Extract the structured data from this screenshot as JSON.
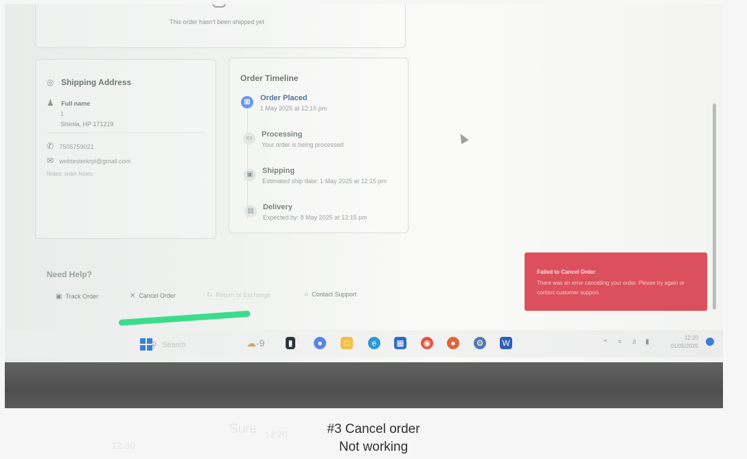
{
  "order_card": {
    "not_shipped_text": "This order hasn't been shipped yet"
  },
  "shipping": {
    "title": "Shipping Address",
    "full_name": "Full name",
    "line1": "1",
    "line2": "Shimla, HP 171219",
    "phone": "7505759021",
    "email": "webtesterkrpl@gmail.com",
    "notes": "Notes: order Notes"
  },
  "timeline": {
    "title": "Order Timeline",
    "steps": [
      {
        "title": "Order Placed",
        "subtitle": "1 May 2025 at 12:15 pm",
        "status": "completed"
      },
      {
        "title": "Processing",
        "subtitle": "Your order is being processed",
        "status": "pending"
      },
      {
        "title": "Shipping",
        "subtitle": "Estimated ship date: 1 May 2025 at 12:15 pm",
        "status": "pending"
      },
      {
        "title": "Delivery",
        "subtitle": "Expected by: 8 May 2025 at 12:15 pm",
        "status": "pending"
      }
    ]
  },
  "help": {
    "title": "Need Help?",
    "track": "Track Order",
    "cancel": "Cancel Order",
    "return": "Return or Exchange",
    "contact": "Contact Support"
  },
  "toast": {
    "title": "Failed to Cancel Order",
    "message": "There was an error cancelling your order. Please try again or contact customer support.",
    "color": "#dc4f5c"
  },
  "taskbar": {
    "search_placeholder": "Search",
    "weather": "-9",
    "time": "12:20",
    "date": "01/05/2025",
    "apps": [
      "start-icon",
      "file-explorer-icon",
      "chat-icon",
      "folder-icon",
      "edge-icon",
      "store-icon",
      "chrome-icon",
      "firefox-icon",
      "settings-icon",
      "word-icon"
    ]
  },
  "caption": {
    "line1": "#3 Cancel order",
    "line2": "Not working"
  },
  "background_chat": {
    "word": "Sure",
    "time_a": "12:20",
    "time_b": "12:30"
  }
}
